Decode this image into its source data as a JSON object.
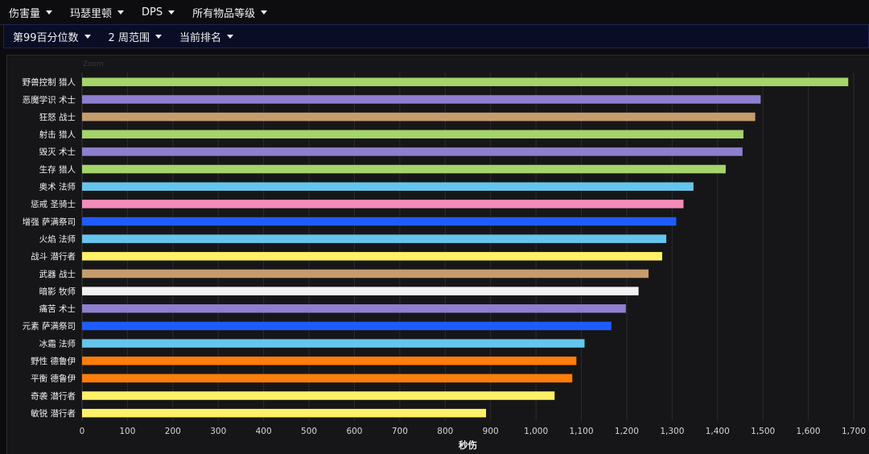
{
  "toolbar_primary": {
    "items": [
      {
        "label": "伤害量"
      },
      {
        "label": "玛瑟里顿"
      },
      {
        "label": "DPS"
      },
      {
        "label": "所有物品等级"
      }
    ]
  },
  "toolbar_secondary": {
    "items": [
      {
        "label": "第99百分位数"
      },
      {
        "label": "2 周范围"
      },
      {
        "label": "当前排名"
      }
    ]
  },
  "chart": {
    "zoom_label": "Zoom"
  },
  "chart_data": {
    "type": "bar",
    "orientation": "horizontal",
    "categories": [
      "野兽控制 猎人",
      "恶魔学识 术士",
      "狂怒 战士",
      "射击 猎人",
      "毁灭 术士",
      "生存 猎人",
      "奥术 法师",
      "惩戒 圣骑士",
      "增强 萨满祭司",
      "火焰 法师",
      "战斗 潜行者",
      "武器 战士",
      "暗影 牧师",
      "痛苦 术士",
      "元素 萨满祭司",
      "冰霜 法师",
      "野性 德鲁伊",
      "平衡 德鲁伊",
      "奇袭 潜行者",
      "敏锐 潜行者"
    ],
    "values": [
      1688,
      1495,
      1483,
      1457,
      1455,
      1418,
      1347,
      1325,
      1309,
      1287,
      1278,
      1248,
      1226,
      1198,
      1166,
      1107,
      1089,
      1080,
      1041,
      890
    ],
    "colors": [
      "#a5d46a",
      "#8f7fcf",
      "#c69b6d",
      "#a5d46a",
      "#8f7fcf",
      "#a5d46a",
      "#66c5ec",
      "#f48cba",
      "#1f5cff",
      "#66c5ec",
      "#fff067",
      "#c69b6d",
      "#f2f2f2",
      "#8f7fcf",
      "#1f5cff",
      "#66c5ec",
      "#ff7d0a",
      "#ff7d0a",
      "#fff067",
      "#fff067"
    ],
    "xlabel": "秒伤",
    "ylabel": "",
    "xlim": [
      0,
      1700
    ],
    "xticks": [
      0,
      100,
      200,
      300,
      400,
      500,
      600,
      700,
      800,
      900,
      1000,
      1100,
      1200,
      1300,
      1400,
      1500,
      1600,
      1700
    ],
    "xtick_labels": [
      "0",
      "100",
      "200",
      "300",
      "400",
      "500",
      "600",
      "700",
      "800",
      "900",
      "1,000",
      "1,100",
      "1,200",
      "1,300",
      "1,400",
      "1,500",
      "1,600",
      "1,700"
    ],
    "grid": "vertical"
  }
}
